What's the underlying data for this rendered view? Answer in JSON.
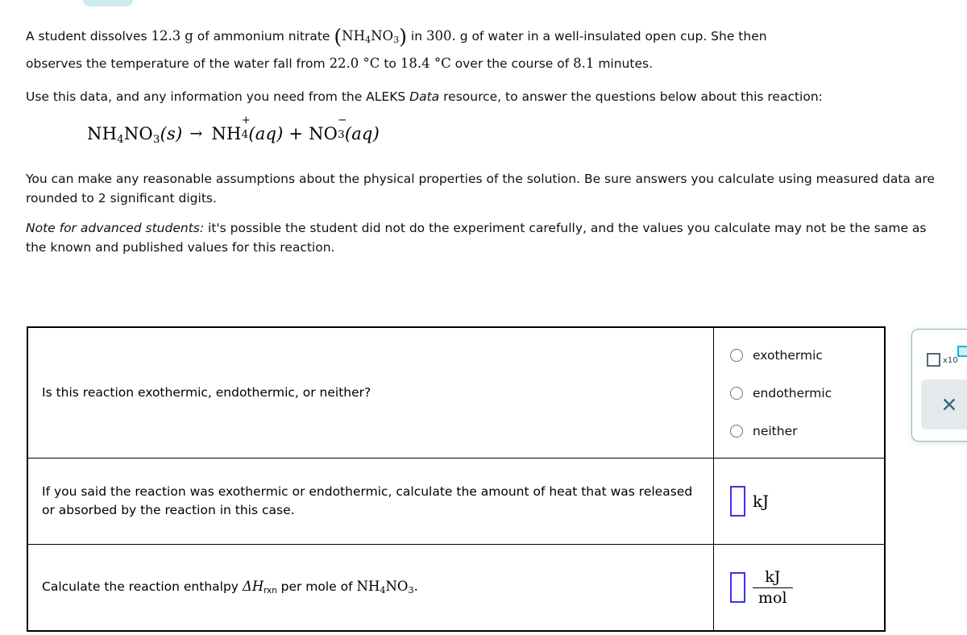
{
  "problem": {
    "p1_a": "A student dissolves",
    "p1_mass": "12.3",
    "p1_b": "g of ammonium nitrate",
    "p1_formula_nh4no3": "NH",
    "p1_sub4": "4",
    "p1_no": "NO",
    "p1_sub3": "3",
    "p1_c": "in",
    "p1_water_mass": "300.",
    "p1_d": "g of water in a well-insulated open cup. She then",
    "p1_e": "observes the temperature of the water fall from",
    "p1_temp_start": "22.0 °C",
    "p1_f": "to",
    "p1_temp_end": "18.4 °C",
    "p1_g": "over the course of",
    "p1_time": "8.1",
    "p1_h": "minutes.",
    "p2_a": "Use this data, and any information you need from the ALEKS",
    "p2_italic": "Data",
    "p2_b": "resource, to answer the questions below about this reaction:",
    "p3": "You can make any reasonable assumptions about the physical properties of the solution. Be sure answers you calculate using measured data are rounded to 2 significant digits.",
    "p4_italic": "Note for advanced students:",
    "p4_rest": "it's possible the student did not do the experiment carefully, and the values you calculate may not be the same as the known and published values for this reaction."
  },
  "equation": {
    "reactant_formula": "NH",
    "reactant_sub1": "4",
    "reactant_mid": "NO",
    "reactant_sub2": "3",
    "reactant_state": "(s)",
    "arrow": "→",
    "product1_formula": "NH",
    "product1_sub": "4",
    "product1_charge": "+",
    "product1_state": "(aq)",
    "plus": "+",
    "product2_formula": "NO",
    "product2_sub": "3",
    "product2_charge": "−",
    "product2_state": "(aq)"
  },
  "table": {
    "rows": [
      {
        "question": "Is this reaction exothermic, endothermic, or neither?",
        "answer_type": "radio",
        "options": [
          "exothermic",
          "endothermic",
          "neither"
        ]
      },
      {
        "question": "If you said the reaction was exothermic or endothermic, calculate the amount of heat that was released or absorbed by the reaction in this case.",
        "answer_type": "input_unit",
        "input_value": "",
        "unit": "kJ"
      },
      {
        "question_a": "Calculate the reaction enthalpy",
        "question_delta": "ΔH",
        "question_sub": "rxn",
        "question_b": "per mole of",
        "question_formula": "NH",
        "question_sub1": "4",
        "question_formula2": "NO",
        "question_sub2": "3",
        "question_period": ".",
        "answer_type": "input_fraction",
        "input_value": "",
        "unit_numerator": "kJ",
        "unit_denominator": "mol"
      }
    ]
  },
  "toolbar": {
    "scientific_notation_label": "x10",
    "clear_label": "✕"
  },
  "colors": {
    "input_border": "#3b32ef",
    "panel_border": "#8fb4bd",
    "accent_cyan": "#1fb4d4",
    "tab_fill": "#cdeaef",
    "clear_button_bg": "#e4e9ec"
  }
}
